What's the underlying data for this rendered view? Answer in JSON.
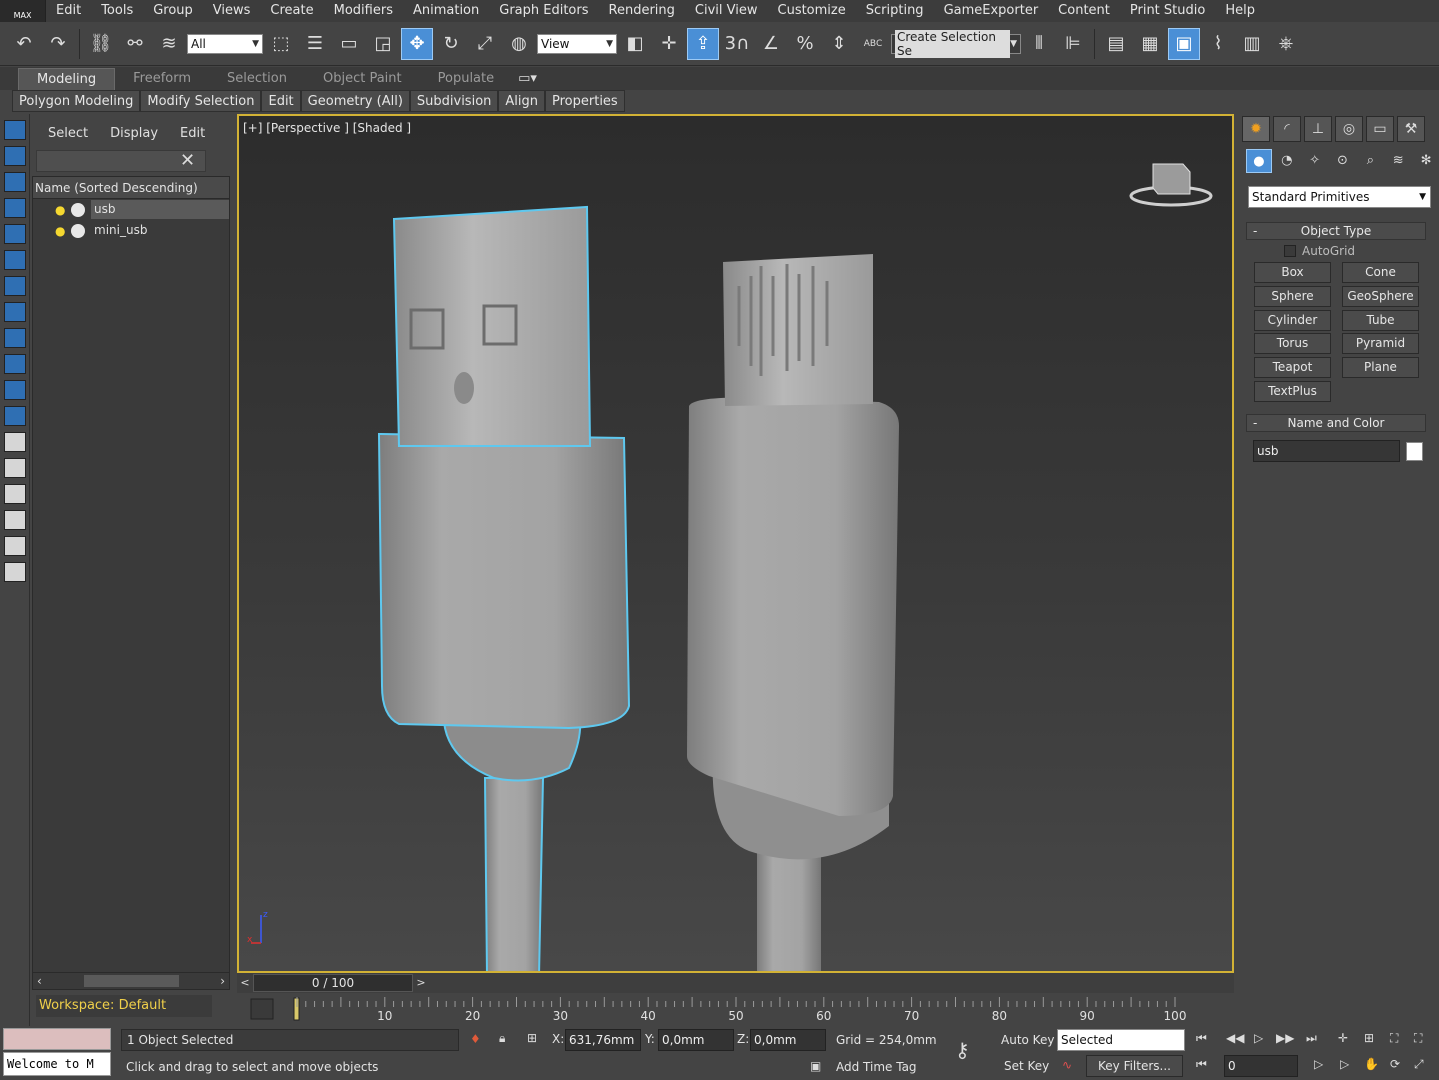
{
  "app": {
    "logo_text": "MAX"
  },
  "menu": [
    "Edit",
    "Tools",
    "Group",
    "Views",
    "Create",
    "Modifiers",
    "Animation",
    "Graph Editors",
    "Rendering",
    "Civil View",
    "Customize",
    "Scripting",
    "GameExporter",
    "Content",
    "Print Studio",
    "Help"
  ],
  "toolbar": {
    "selection_filter": "All",
    "reference_coord": "View",
    "named_selection_placeholder": "Create Selection Se",
    "snap_label": "3",
    "percent_label": "%",
    "spinner_label": "ABC",
    "icons": [
      "undo-icon",
      "redo-icon",
      "link-icon",
      "unlink-icon",
      "bind-spacewarp-icon",
      "select-object-icon",
      "select-by-name-icon",
      "rect-region-icon",
      "window-crossing-icon",
      "select-move-icon",
      "rotate-icon",
      "scale-icon",
      "place-icon",
      "select-manipulate-icon",
      "pivot-icon",
      "keyboard-shortcut-icon",
      "snap-icon",
      "angle-snap-icon",
      "percent-snap-icon",
      "spinner-snap-icon",
      "edit-named-selection-icon",
      "mirror-icon",
      "align-icon",
      "layer-explorer-icon",
      "ribbon-toggle-icon",
      "curve-editor-icon",
      "schematic-view-icon",
      "material-editor-icon",
      "render-setup-icon"
    ]
  },
  "ribbon": {
    "tabs": [
      "Modeling",
      "Freeform",
      "Selection",
      "Object Paint",
      "Populate"
    ],
    "active_tab": "Modeling",
    "buttons": [
      "Polygon Modeling",
      "Modify Selection",
      "Edit",
      "Geometry (All)",
      "Subdivision",
      "Align",
      "Properties"
    ]
  },
  "scene_explorer": {
    "menu": [
      "Select",
      "Display",
      "Edit"
    ],
    "search_value": "",
    "column_header": "Name (Sorted Descending)",
    "items": [
      {
        "name": "usb",
        "selected": true
      },
      {
        "name": "mini_usb",
        "selected": false
      }
    ],
    "workspace": "Workspace: Default"
  },
  "viewport": {
    "label": "[+] [Perspective ] [Shaded ]",
    "axis_x": "x",
    "axis_z": "z"
  },
  "time_slider": {
    "position": "0 / 100",
    "prev": "<",
    "next": ">"
  },
  "trackbar": {
    "ticks": [
      "10",
      "20",
      "30",
      "40",
      "50",
      "60",
      "70",
      "80",
      "90",
      "100"
    ]
  },
  "status": {
    "maxscript": "Welcome to M",
    "selection": "1 Object Selected",
    "prompt": "Click and drag to select and move objects",
    "x_label": "X:",
    "x_value": "631,76mm",
    "y_label": "Y:",
    "y_value": "0,0mm",
    "z_label": "Z:",
    "z_value": "0,0mm",
    "grid": "Grid = 254,0mm",
    "add_time_tag": "Add Time Tag",
    "auto_key": "Auto Key",
    "set_key": "Set Key",
    "key_mode": "Selected",
    "key_filters": "Key Filters...",
    "current_frame": "0"
  },
  "command_panel": {
    "category": "Standard Primitives",
    "object_type_title": "Object Type",
    "autogrid": "AutoGrid",
    "primitives": [
      "Box",
      "Cone",
      "Sphere",
      "GeoSphere",
      "Cylinder",
      "Tube",
      "Torus",
      "Pyramid",
      "Teapot",
      "Plane",
      "TextPlus"
    ],
    "name_color_title": "Name and Color",
    "object_name": "usb",
    "object_color": "#ffffff",
    "rollout_toggle": "-"
  },
  "colors": {
    "accent_blue": "#4a8fd6",
    "viewport_border": "#d2b235",
    "selection_outline": "#5ec8ef",
    "workspace_text": "#f0d04a"
  }
}
